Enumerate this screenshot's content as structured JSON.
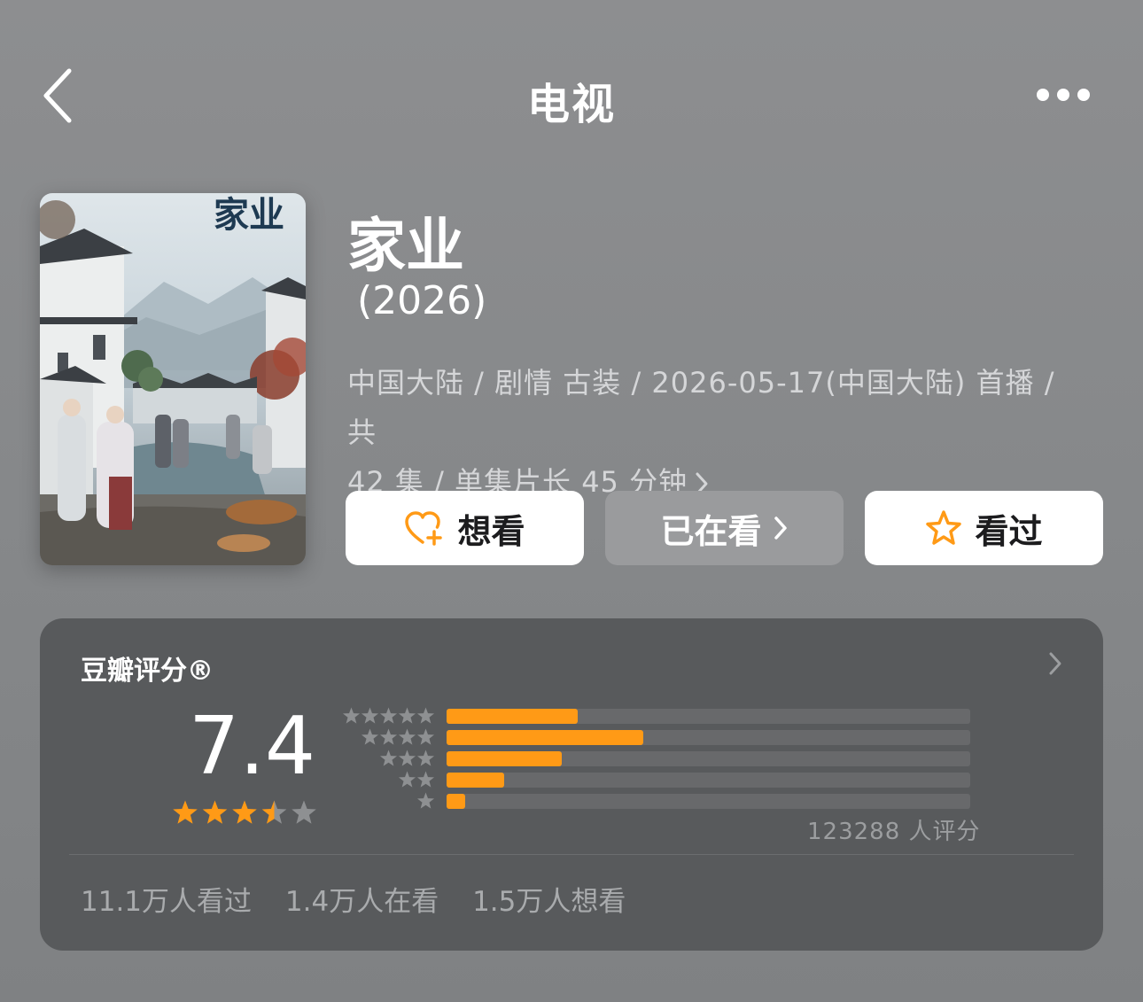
{
  "nav": {
    "title": "电视"
  },
  "show": {
    "poster_title": "家业",
    "title": "家业",
    "year": "(2026)",
    "meta_line1": "中国大陆 / 剧情 古装 / 2026-05-17(中国大陆) 首播 / 共",
    "meta_line2": "42 集 / 单集片长 45 分钟"
  },
  "actions": {
    "want": "想看",
    "watching": "已在看",
    "watched": "看过"
  },
  "rating": {
    "label": "豆瓣评分®",
    "score": "7.4",
    "stars_value": 3.5,
    "stars_max": 5,
    "distribution": [
      {
        "stars": 5,
        "fraction": 0.25
      },
      {
        "stars": 4,
        "fraction": 0.375
      },
      {
        "stars": 3,
        "fraction": 0.22
      },
      {
        "stars": 2,
        "fraction": 0.11
      },
      {
        "stars": 1,
        "fraction": 0.035
      }
    ],
    "count_text": "123288 人评分"
  },
  "stats": {
    "watched": "11.1万人看过",
    "watching": "1.4万人在看",
    "want": "1.5万人想看"
  },
  "colors": {
    "accent": "#ff9a16",
    "card_bg": "#585a5c",
    "page_bg": "#86888a"
  }
}
